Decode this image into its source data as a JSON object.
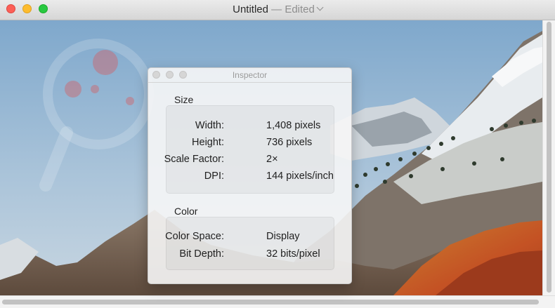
{
  "window": {
    "title": "Untitled",
    "separator": "—",
    "status": "Edited"
  },
  "inspector": {
    "title": "Inspector",
    "size_section": {
      "label": "Size",
      "rows": [
        {
          "key": "Width:",
          "value": "1,408 pixels"
        },
        {
          "key": "Height:",
          "value": "736 pixels"
        },
        {
          "key": "Scale Factor:",
          "value": "2×"
        },
        {
          "key": "DPI:",
          "value": "144 pixels/inch"
        }
      ]
    },
    "color_section": {
      "label": "Color",
      "rows": [
        {
          "key": "Color Space:",
          "value": "Display"
        },
        {
          "key": "Bit Depth:",
          "value": "32 bits/pixel"
        }
      ]
    }
  },
  "colors": {
    "close": "#fc5f57",
    "minimize": "#fdbc2e",
    "maximize": "#28c840"
  }
}
